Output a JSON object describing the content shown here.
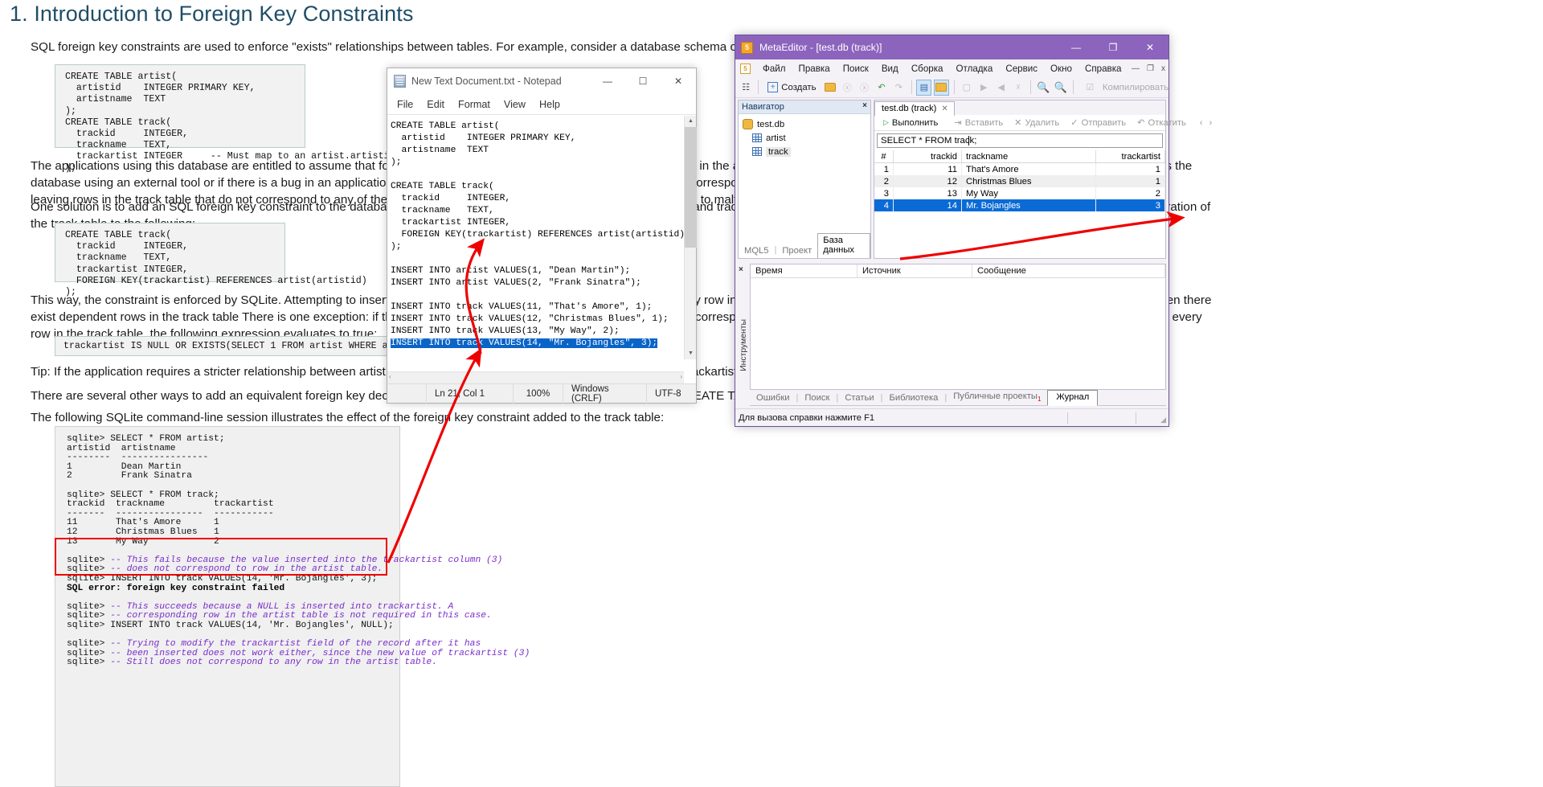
{
  "document": {
    "title": "1. Introduction to Foreign Key Constraints",
    "paragraphs": [
      "SQL foreign key constraints are used to enforce \"exists\" relationships between tables. For example, consider a database schema created using the following SQL commands:",
      "The applications using this database are entitled to assume that for each row in the track table there is a corresponding row in the artist table. After all, the comment in the schema says so. However, if a user edits the database using an external tool or if there is a bug in an application, rows might be inserted into the track table that do not correspond to any rows in the artist table. Or rows might be deleted from the artist table, leaving rows in the track table that do not correspond to any of the remaining rows in artist. This might cause the application to malfunction.",
      "One solution is to add an SQL foreign key constraint to the database schema to enforce the relationship between the artist and track tables. To do so, a foreign key definition may be added by modifying the declaration of the track table to the following:",
      "This way, the constraint is enforced by SQLite. Attempting to insert a row into the track table that does not correspond to any row in the artist table will fail, as will attempting to delete a row from the artist table when there exist dependent rows in the track table There is one exception: if the foreign key column in the track table is NULL, then no corresponding entry in the artist table is required. Expressed in SQL, this means that for every row in the track table, the following expression evaluates to true:",
      "Tip: If the application requires a stricter relationship between artist and track, where NULL values are not permitted in the trackartist column, simply add the appropriate \"NOT NULL\" constraint to the schema.",
      "There are several other ways to add an equivalent foreign key declaration to a CREATE TABLE statement. Refer to the CREATE TABLE documentation for details.",
      "The following SQLite command-line session illustrates the effect of the foreign key constraint added to the track table:"
    ],
    "code_block_1": "CREATE TABLE artist(\n  artistid    INTEGER PRIMARY KEY,\n  artistname  TEXT\n);\nCREATE TABLE track(\n  trackid     INTEGER,\n  trackname   TEXT,\n  trackartist INTEGER     -- Must map to an artist.artistid!\n);",
    "code_block_2": "CREATE TABLE track(\n  trackid     INTEGER,\n  trackname   TEXT,\n  trackartist INTEGER,\n  FOREIGN KEY(trackartist) REFERENCES artist(artistid)\n);",
    "inline_expr": "trackartist IS NULL OR EXISTS(SELECT 1 FROM artist WHERE artistid=trackartist)",
    "console_lines": [
      {
        "t": "plain",
        "s": "sqlite> SELECT * FROM artist;"
      },
      {
        "t": "plain",
        "s": "artistid  artistname"
      },
      {
        "t": "plain",
        "s": "--------  ----------------"
      },
      {
        "t": "plain",
        "s": "1         Dean Martin"
      },
      {
        "t": "plain",
        "s": "2         Frank Sinatra"
      },
      {
        "t": "plain",
        "s": ""
      },
      {
        "t": "plain",
        "s": "sqlite> SELECT * FROM track;"
      },
      {
        "t": "plain",
        "s": "trackid  trackname         trackartist"
      },
      {
        "t": "plain",
        "s": "-------  ----------------  -----------"
      },
      {
        "t": "plain",
        "s": "11       That's Amore      1"
      },
      {
        "t": "plain",
        "s": "12       Christmas Blues   1"
      },
      {
        "t": "plain",
        "s": "13       My Way            2"
      },
      {
        "t": "plain",
        "s": ""
      },
      {
        "t": "cmt",
        "p": "sqlite> ",
        "s": "-- This fails because the value inserted into the trackartist column (3)"
      },
      {
        "t": "cmt",
        "p": "sqlite> ",
        "s": "-- does not correspond to row in the artist table."
      },
      {
        "t": "plain",
        "s": "sqlite> INSERT INTO track VALUES(14, 'Mr. Bojangles', 3);"
      },
      {
        "t": "err",
        "s": "SQL error: foreign key constraint failed"
      },
      {
        "t": "plain",
        "s": ""
      },
      {
        "t": "cmt",
        "p": "sqlite> ",
        "s": "-- This succeeds because a NULL is inserted into trackartist. A"
      },
      {
        "t": "cmt",
        "p": "sqlite> ",
        "s": "-- corresponding row in the artist table is not required in this case."
      },
      {
        "t": "plain",
        "s": "sqlite> INSERT INTO track VALUES(14, 'Mr. Bojangles', NULL);"
      },
      {
        "t": "plain",
        "s": ""
      },
      {
        "t": "cmt",
        "p": "sqlite> ",
        "s": "-- Trying to modify the trackartist field of the record after it has"
      },
      {
        "t": "cmt",
        "p": "sqlite> ",
        "s": "-- been inserted does not work either, since the new value of trackartist (3)"
      },
      {
        "t": "cmt",
        "p": "sqlite> ",
        "s": "-- Still does not correspond to any row in the artist table."
      }
    ]
  },
  "notepad": {
    "title": "New Text Document.txt - Notepad",
    "menu": [
      "File",
      "Edit",
      "Format",
      "View",
      "Help"
    ],
    "window_buttons": {
      "minimize": "—",
      "maximize": "☐",
      "close": "✕"
    },
    "content_before": "CREATE TABLE artist(\n  artistid    INTEGER PRIMARY KEY,\n  artistname  TEXT\n);\n\nCREATE TABLE track(\n  trackid     INTEGER,\n  trackname   TEXT,\n  trackartist INTEGER,\n  FOREIGN KEY(trackartist) REFERENCES artist(artistid)\n);\n\nINSERT INTO artist VALUES(1, \"Dean Martin\");\nINSERT INTO artist VALUES(2, \"Frank Sinatra\");\n\nINSERT INTO track VALUES(11, \"That's Amore\", 1);\nINSERT INTO track VALUES(12, \"Christmas Blues\", 1);\nINSERT INTO track VALUES(13, \"My Way\", 2);\n",
    "content_selected": "INSERT INTO track VALUES(14, \"Mr. Bojangles\", 3);",
    "status": {
      "position": "Ln 21, Col 1",
      "zoom": "100%",
      "line_ending": "Windows (CRLF)",
      "encoding": "UTF-8"
    },
    "scroll_left_glyph": "‹",
    "scroll_right_glyph": "›"
  },
  "metaeditor": {
    "title": "MetaEditor - [test.db (track)]",
    "app_icon_label": "5",
    "window_buttons": {
      "minimize": "—",
      "maximize": "❐",
      "close": "✕"
    },
    "mdi_buttons": {
      "minimize": "—",
      "restore": "❐",
      "close": "x"
    },
    "menu": [
      "Файл",
      "Правка",
      "Поиск",
      "Вид",
      "Сборка",
      "Отладка",
      "Сервис",
      "Окно",
      "Справка"
    ],
    "toolbar": {
      "create_label": "Создать",
      "compile_label": "Компилировать"
    },
    "navigator": {
      "title": "Навигатор",
      "close_glyph": "×",
      "root": "test.db",
      "children": [
        "artist",
        "track"
      ],
      "selected_child": "track",
      "tabs": [
        "MQL5",
        "Проект",
        "База данных"
      ],
      "active_tab": "База данных"
    },
    "query": {
      "tab_label": "test.db (track)",
      "tab_close_glyph": "✕",
      "toolbar": [
        {
          "label": "Выполнить",
          "icon": "▷",
          "enabled": true
        },
        {
          "label": "Вставить",
          "icon": "⇥",
          "enabled": false
        },
        {
          "label": "Удалить",
          "icon": "✕",
          "enabled": false
        },
        {
          "label": "Отправить",
          "icon": "✓",
          "enabled": false
        },
        {
          "label": "Откатить",
          "icon": "↶",
          "enabled": false
        }
      ],
      "sql": "SELECT * FROM track;",
      "columns": [
        "#",
        "trackid",
        "trackname",
        "trackartist"
      ],
      "rows": [
        {
          "n": "1",
          "trackid": "11",
          "trackname": "That's Amore",
          "trackartist": "1"
        },
        {
          "n": "2",
          "trackid": "12",
          "trackname": "Christmas Blues",
          "trackartist": "1"
        },
        {
          "n": "3",
          "trackid": "13",
          "trackname": "My Way",
          "trackartist": "2"
        },
        {
          "n": "4",
          "trackid": "14",
          "trackname": "Mr. Bojangles",
          "trackartist": "3"
        }
      ],
      "selected_row_index": 3,
      "nav_prev_glyph": "‹",
      "nav_next_glyph": "›"
    },
    "log": {
      "close_glyph": "×",
      "columns": [
        "Время",
        "Источник",
        "Сообщение"
      ],
      "rows": []
    },
    "side_label": "Инструменты",
    "bottom_tabs": [
      "Ошибки",
      "Поиск",
      "Статьи",
      "Библиотека",
      "Публичные проекты",
      "Журнал"
    ],
    "bottom_tabs_badge": "1",
    "active_bottom_tab": "Журнал",
    "status_text": "Для вызова справки нажмите F1"
  },
  "colors": {
    "title_blue": "#1f4e66",
    "metaeditor_purple": "#8c64bd",
    "selection_blue": "#0a6bd6",
    "notepad_selection": "#0a64c8",
    "annotation_red": "#ee0000",
    "comment_purple": "#7a2ecb"
  }
}
